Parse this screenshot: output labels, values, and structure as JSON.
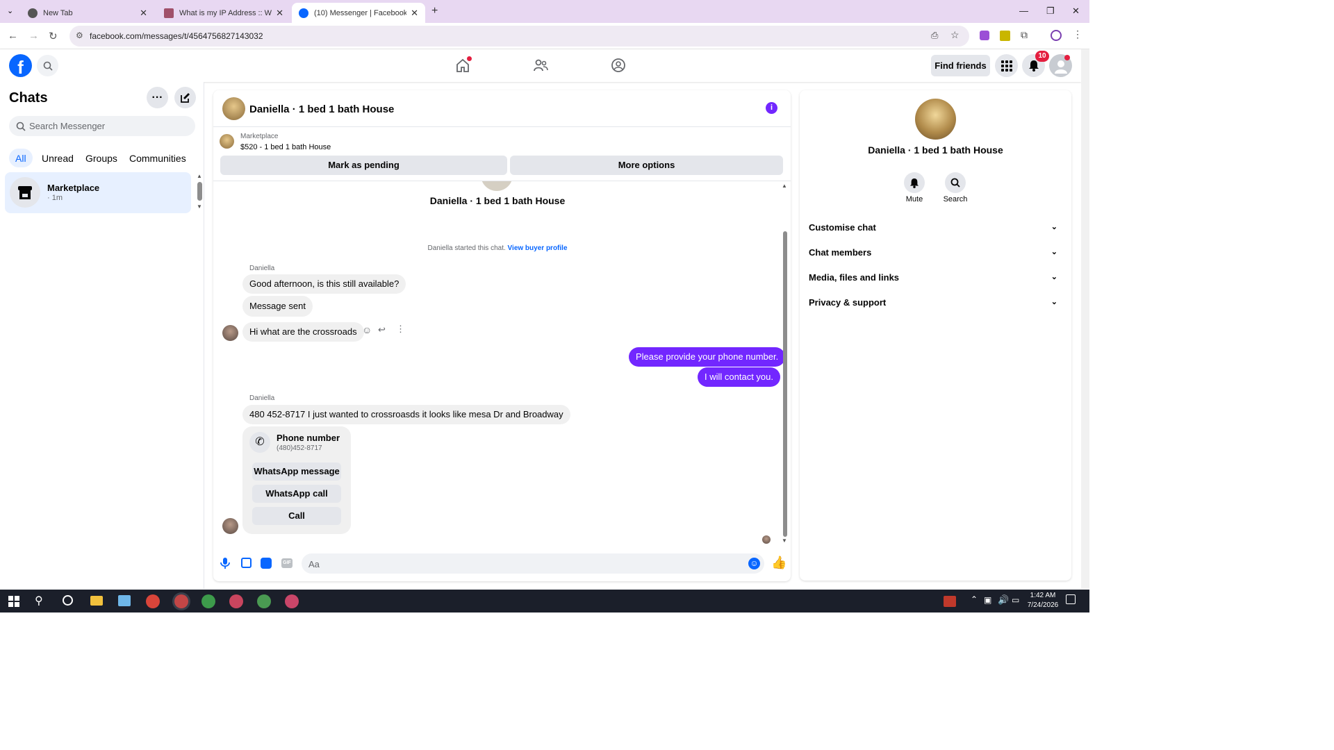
{
  "browser": {
    "tabs": [
      {
        "title": "New Tab"
      },
      {
        "title": "What is my IP Address :: WebBr"
      },
      {
        "title": "(10) Messenger | Facebook"
      }
    ],
    "url": "facebook.com/messages/t/4564756827143032"
  },
  "header": {
    "find_friends": "Find friends",
    "notif_count": "10"
  },
  "left": {
    "title": "Chats",
    "search_placeholder": "Search Messenger",
    "filters": [
      "All",
      "Unread",
      "Groups",
      "Communities"
    ],
    "chats": [
      {
        "name": "Marketplace",
        "meta": "· 1m"
      }
    ]
  },
  "chat": {
    "title": "Daniella · 1 bed 1 bath House",
    "listing_source": "Marketplace",
    "listing": "$520 - 1 bed 1 bath House",
    "mark_pending": "Mark as pending",
    "more_options": "More options",
    "intro_name": "Daniella · 1 bed 1 bath House",
    "started_text": "Daniella started this chat.",
    "view_buyer": "View buyer profile",
    "sender": "Daniella",
    "msg1": "Good afternoon, is this still available?",
    "msg2": "Message sent",
    "msg3": "Hi what are the crossroads",
    "my1": "Please provide your phone number.",
    "my2": "I will contact you.",
    "sender2": "Daniella",
    "msg4": "480 452-8717 I just wanted to crossroasds it looks like mesa Dr and Broadway",
    "phone_label": "Phone number",
    "phone_value": "(480)452-8717",
    "wa_message": "WhatsApp message",
    "wa_call": "WhatsApp call",
    "call": "Call",
    "composer_placeholder": "Aa"
  },
  "right": {
    "name": "Daniella · 1 bed 1 bath House",
    "mute": "Mute",
    "search": "Search",
    "sections": [
      "Customise chat",
      "Chat members",
      "Media, files and links",
      "Privacy & support"
    ]
  },
  "taskbar": {
    "time": "1:42 AM",
    "date": "7/24/2026"
  },
  "colors": {
    "accent": "#7227ff",
    "fb_blue": "#0866ff"
  }
}
